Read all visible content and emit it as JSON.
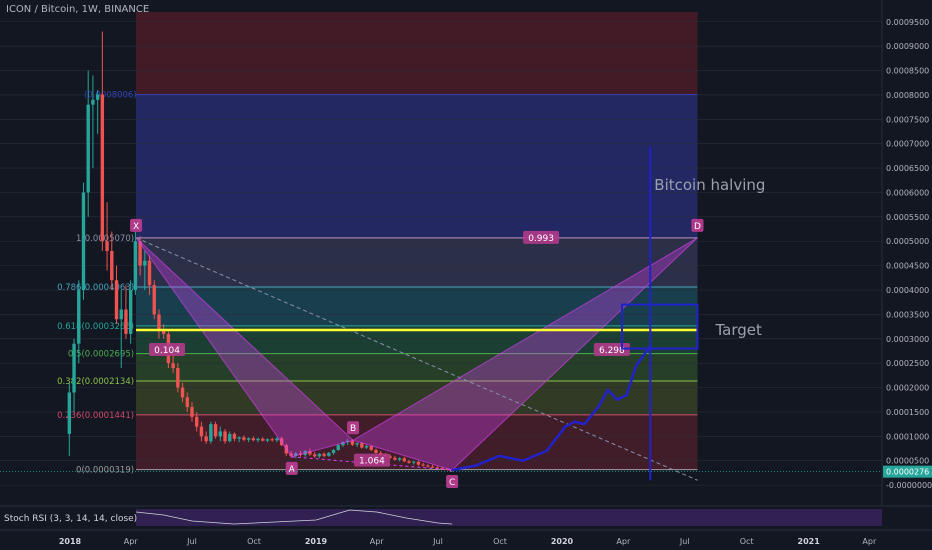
{
  "header": {
    "title": "ICON / Bitcoin, 1W, BINANCE"
  },
  "colors": {
    "background": "#131722",
    "up": "#26a69a",
    "down": "#ef5350",
    "pattern": "#e040fb",
    "projection": "#2222cc",
    "target_line": "#ffff33",
    "price_tag": "#26a69a"
  },
  "chart_data": {
    "type": "candlestick",
    "x_ticks": [
      "2018",
      "Apr",
      "Jul",
      "Oct",
      "2019",
      "Apr",
      "Jul",
      "Oct",
      "2020",
      "Apr",
      "Jul",
      "Oct",
      "2021",
      "Apr"
    ],
    "y_ticks": [
      "0.0009500",
      "0.0009000",
      "0.0008500",
      "0.0008000",
      "0.0007500",
      "0.0007000",
      "0.0006500",
      "0.0006000",
      "0.0005500",
      "0.0005000",
      "0.0004500",
      "0.0004000",
      "0.0003500",
      "0.0003000",
      "0.0002500",
      "0.0002000",
      "0.0001500",
      "0.0001000",
      "0.0000500",
      "-0.0000000"
    ],
    "last_price": "0.0000276",
    "y_range": [
      -1e-05,
      0.00097
    ],
    "fib_levels": [
      {
        "ratio": "1",
        "value": 0.0008006,
        "label": "(0.0008006)"
      },
      {
        "ratio": "1",
        "value": 0.000507,
        "label": "1(0.0005070)"
      },
      {
        "ratio": "0.786",
        "value": 0.0004063,
        "label": "0.786(0.0004063)"
      },
      {
        "ratio": "0.618",
        "value": 0.0003265,
        "label": "0.618(0.0003265)"
      },
      {
        "ratio": "0.5",
        "value": 0.0002695,
        "label": "0.5(0.0002695)"
      },
      {
        "ratio": "0.382",
        "value": 0.0002134,
        "label": "0.382(0.0002134)"
      },
      {
        "ratio": "0.236",
        "value": 0.0001441,
        "label": "0.236(0.0001441)"
      },
      {
        "ratio": "0",
        "value": 3.19e-05,
        "label": "0(0.0000319)"
      }
    ],
    "harmonic_points": [
      {
        "name": "X",
        "date": "2018-04-09",
        "value": 0.000507
      },
      {
        "name": "A",
        "date": "2018-11-26",
        "value": 5.8e-05
      },
      {
        "name": "B",
        "date": "2019-02-25",
        "value": 9.2e-05
      },
      {
        "name": "C",
        "date": "2019-07-22",
        "value": 3.1e-05
      },
      {
        "name": "D",
        "date": "2020-07-20",
        "value": 0.000507
      }
    ],
    "ratios": [
      {
        "label": "0.993",
        "date": "2019-12-01",
        "value": 0.000507
      },
      {
        "label": "0.104",
        "date": "2018-05-25",
        "value": 0.000277
      },
      {
        "label": "6.298",
        "date": "2020-03-15",
        "value": 0.000277
      },
      {
        "label": "1.064",
        "date": "2019-03-25",
        "value": 5.02e-05
      }
    ],
    "annotations": {
      "halving": "Bitcoin halving",
      "target": "Target"
    },
    "target_level": 0.000318,
    "target_box": {
      "start": "2020-03-30",
      "end": "2020-07-20",
      "top": 0.00037,
      "bottom": 0.00028
    },
    "halving_date": "2020-05-11",
    "halving_top": 0.000693,
    "indicator": {
      "title": "Stoch RSI (3, 3, 14, 14, close)"
    },
    "projection_path": [
      {
        "date": "2019-07-22",
        "value": 3.1e-05
      },
      {
        "date": "2019-08-26",
        "value": 4e-05
      },
      {
        "date": "2019-09-30",
        "value": 6e-05
      },
      {
        "date": "2019-11-04",
        "value": 5e-05
      },
      {
        "date": "2019-12-09",
        "value": 7e-05
      },
      {
        "date": "2020-01-06",
        "value": 0.00012
      },
      {
        "date": "2020-01-20",
        "value": 0.00013
      },
      {
        "date": "2020-02-03",
        "value": 0.000125
      },
      {
        "date": "2020-02-24",
        "value": 0.00016
      },
      {
        "date": "2020-03-09",
        "value": 0.000195
      },
      {
        "date": "2020-03-23",
        "value": 0.000175
      },
      {
        "date": "2020-04-06",
        "value": 0.000185
      },
      {
        "date": "2020-04-20",
        "value": 0.000245
      },
      {
        "date": "2020-05-11",
        "value": 0.000285
      }
    ],
    "candles": [
      {
        "date": "2017-12-31",
        "open": 0.000105,
        "high": 0.00021,
        "low": 6e-05,
        "close": 0.00019
      },
      {
        "date": "2018-01-07",
        "open": 0.00019,
        "high": 0.0003,
        "low": 0.00015,
        "close": 0.00029
      },
      {
        "date": "2018-01-14",
        "open": 0.00029,
        "high": 0.00042,
        "low": 0.00025,
        "close": 0.0004
      },
      {
        "date": "2018-01-21",
        "open": 0.0004,
        "high": 0.00062,
        "low": 0.00038,
        "close": 0.0006
      },
      {
        "date": "2018-01-28",
        "open": 0.0006,
        "high": 0.00085,
        "low": 0.00055,
        "close": 0.00078
      },
      {
        "date": "2018-02-04",
        "open": 0.00078,
        "high": 0.00084,
        "low": 0.00065,
        "close": 0.00079
      },
      {
        "date": "2018-02-11",
        "open": 0.00079,
        "high": 0.00081,
        "low": 0.00072,
        "close": 0.000801
      },
      {
        "date": "2018-02-18",
        "open": 0.000801,
        "high": 0.00093,
        "low": 0.00048,
        "close": 0.0005
      },
      {
        "date": "2018-02-25",
        "open": 0.0005,
        "high": 0.00058,
        "low": 0.00044,
        "close": 0.00048
      },
      {
        "date": "2018-03-04",
        "open": 0.00048,
        "high": 0.00052,
        "low": 0.0004,
        "close": 0.00042
      },
      {
        "date": "2018-03-11",
        "open": 0.00042,
        "high": 0.00045,
        "low": 0.00033,
        "close": 0.00034
      },
      {
        "date": "2018-03-18",
        "open": 0.00034,
        "high": 0.0004,
        "low": 0.00024,
        "close": 0.00036
      },
      {
        "date": "2018-03-25",
        "open": 0.00036,
        "high": 0.00041,
        "low": 0.0003,
        "close": 0.00031
      },
      {
        "date": "2018-04-01",
        "open": 0.00031,
        "high": 0.00042,
        "low": 0.00029,
        "close": 0.0004
      },
      {
        "date": "2018-04-08",
        "open": 0.0004,
        "high": 0.00052,
        "low": 0.00039,
        "close": 0.0005
      },
      {
        "date": "2018-04-15",
        "open": 0.0005,
        "high": 0.00051,
        "low": 0.00043,
        "close": 0.00045
      },
      {
        "date": "2018-04-22",
        "open": 0.00045,
        "high": 0.00048,
        "low": 0.0004,
        "close": 0.00046
      },
      {
        "date": "2018-04-29",
        "open": 0.00046,
        "high": 0.00047,
        "low": 0.00039,
        "close": 0.00041
      },
      {
        "date": "2018-05-06",
        "open": 0.00041,
        "high": 0.00042,
        "low": 0.00034,
        "close": 0.00035
      },
      {
        "date": "2018-05-13",
        "open": 0.00035,
        "high": 0.00036,
        "low": 0.0003,
        "close": 0.00032
      },
      {
        "date": "2018-05-20",
        "open": 0.00032,
        "high": 0.00033,
        "low": 0.0003,
        "close": 0.00031
      },
      {
        "date": "2018-05-27",
        "open": 0.00031,
        "high": 0.00032,
        "low": 0.00024,
        "close": 0.00025
      },
      {
        "date": "2018-06-03",
        "open": 0.00025,
        "high": 0.00027,
        "low": 0.00023,
        "close": 0.00024
      },
      {
        "date": "2018-06-10",
        "open": 0.00024,
        "high": 0.00025,
        "low": 0.00019,
        "close": 0.0002
      },
      {
        "date": "2018-06-17",
        "open": 0.0002,
        "high": 0.00021,
        "low": 0.00017,
        "close": 0.00018
      },
      {
        "date": "2018-06-24",
        "open": 0.00018,
        "high": 0.00019,
        "low": 0.00015,
        "close": 0.00016
      },
      {
        "date": "2018-07-01",
        "open": 0.00016,
        "high": 0.00017,
        "low": 0.00013,
        "close": 0.00014
      },
      {
        "date": "2018-07-08",
        "open": 0.00014,
        "high": 0.00015,
        "low": 0.00011,
        "close": 0.00012
      },
      {
        "date": "2018-07-15",
        "open": 0.00012,
        "high": 0.00013,
        "low": 9e-05,
        "close": 0.0001
      },
      {
        "date": "2018-07-22",
        "open": 0.0001,
        "high": 0.00011,
        "low": 8.5e-05,
        "close": 9e-05
      },
      {
        "date": "2018-07-29",
        "open": 9e-05,
        "high": 0.00013,
        "low": 8.5e-05,
        "close": 0.000125
      },
      {
        "date": "2018-08-05",
        "open": 0.000125,
        "high": 0.00013,
        "low": 9.5e-05,
        "close": 0.0001
      },
      {
        "date": "2018-08-12",
        "open": 0.0001,
        "high": 0.00012,
        "low": 9e-05,
        "close": 0.00011
      },
      {
        "date": "2018-08-19",
        "open": 0.00011,
        "high": 0.000115,
        "low": 8.5e-05,
        "close": 9e-05
      },
      {
        "date": "2018-08-26",
        "open": 9e-05,
        "high": 0.00011,
        "low": 8.8e-05,
        "close": 0.000105
      },
      {
        "date": "2018-09-02",
        "open": 0.000105,
        "high": 0.000108,
        "low": 9e-05,
        "close": 9.5e-05
      },
      {
        "date": "2018-09-09",
        "open": 9.5e-05,
        "high": 0.0001,
        "low": 8.8e-05,
        "close": 9.8e-05
      },
      {
        "date": "2018-09-16",
        "open": 9.8e-05,
        "high": 0.000102,
        "low": 9e-05,
        "close": 9.3e-05
      },
      {
        "date": "2018-09-23",
        "open": 9.3e-05,
        "high": 9.8e-05,
        "low": 8.8e-05,
        "close": 9.6e-05
      },
      {
        "date": "2018-09-30",
        "open": 9.6e-05,
        "high": 0.0001,
        "low": 9e-05,
        "close": 9.2e-05
      },
      {
        "date": "2018-10-07",
        "open": 9.2e-05,
        "high": 9.7e-05,
        "low": 8.8e-05,
        "close": 9.5e-05
      },
      {
        "date": "2018-10-14",
        "open": 9.5e-05,
        "high": 9.8e-05,
        "low": 9e-05,
        "close": 9.1e-05
      },
      {
        "date": "2018-10-21",
        "open": 9.1e-05,
        "high": 9.6e-05,
        "low": 8.8e-05,
        "close": 9.4e-05
      },
      {
        "date": "2018-10-28",
        "open": 9.4e-05,
        "high": 9.7e-05,
        "low": 8.9e-05,
        "close": 9.2e-05
      },
      {
        "date": "2018-11-04",
        "open": 9.2e-05,
        "high": 9.8e-05,
        "low": 8.8e-05,
        "close": 9.6e-05
      },
      {
        "date": "2018-11-11",
        "open": 9.6e-05,
        "high": 9.9e-05,
        "low": 8e-05,
        "close": 8.2e-05
      },
      {
        "date": "2018-11-18",
        "open": 8.2e-05,
        "high": 8.5e-05,
        "low": 6e-05,
        "close": 6.5e-05
      },
      {
        "date": "2018-11-25",
        "open": 6.5e-05,
        "high": 7e-05,
        "low": 5.6e-05,
        "close": 6e-05
      },
      {
        "date": "2018-12-02",
        "open": 6e-05,
        "high": 6.8e-05,
        "low": 5.5e-05,
        "close": 6.5e-05
      },
      {
        "date": "2018-12-09",
        "open": 6.5e-05,
        "high": 7e-05,
        "low": 5.8e-05,
        "close": 6.2e-05
      },
      {
        "date": "2018-12-16",
        "open": 6.2e-05,
        "high": 7.2e-05,
        "low": 5.8e-05,
        "close": 7e-05
      },
      {
        "date": "2018-12-23",
        "open": 7e-05,
        "high": 7.5e-05,
        "low": 6e-05,
        "close": 6.3e-05
      },
      {
        "date": "2018-12-30",
        "open": 6.3e-05,
        "high": 6.8e-05,
        "low": 5.6e-05,
        "close": 5.9e-05
      },
      {
        "date": "2019-01-06",
        "open": 5.9e-05,
        "high": 6.6e-05,
        "low": 5.5e-05,
        "close": 6.4e-05
      },
      {
        "date": "2019-01-13",
        "open": 6.4e-05,
        "high": 6.7e-05,
        "low": 5.7e-05,
        "close": 6e-05
      },
      {
        "date": "2019-01-20",
        "open": 6e-05,
        "high": 6.8e-05,
        "low": 5.8e-05,
        "close": 6.6e-05
      },
      {
        "date": "2019-01-27",
        "open": 6.6e-05,
        "high": 7.4e-05,
        "low": 6.2e-05,
        "close": 7.2e-05
      },
      {
        "date": "2019-02-03",
        "open": 7.2e-05,
        "high": 8.5e-05,
        "low": 7e-05,
        "close": 8.2e-05
      },
      {
        "date": "2019-02-10",
        "open": 8.2e-05,
        "high": 9e-05,
        "low": 7.8e-05,
        "close": 8.8e-05
      },
      {
        "date": "2019-02-17",
        "open": 8.8e-05,
        "high": 9.5e-05,
        "low": 8.2e-05,
        "close": 9.1e-05
      },
      {
        "date": "2019-02-24",
        "open": 9.1e-05,
        "high": 9.4e-05,
        "low": 8e-05,
        "close": 8.3e-05
      },
      {
        "date": "2019-03-03",
        "open": 8.3e-05,
        "high": 8.8e-05,
        "low": 7.8e-05,
        "close": 8.6e-05
      },
      {
        "date": "2019-03-10",
        "open": 8.6e-05,
        "high": 8.8e-05,
        "low": 7.5e-05,
        "close": 7.7e-05
      },
      {
        "date": "2019-03-17",
        "open": 7.7e-05,
        "high": 8.3e-05,
        "low": 7.4e-05,
        "close": 8e-05
      },
      {
        "date": "2019-03-24",
        "open": 8e-05,
        "high": 8.2e-05,
        "low": 7e-05,
        "close": 7.2e-05
      },
      {
        "date": "2019-03-31",
        "open": 7.2e-05,
        "high": 7.5e-05,
        "low": 6.4e-05,
        "close": 6.6e-05
      },
      {
        "date": "2019-04-07",
        "open": 6.6e-05,
        "high": 7e-05,
        "low": 6e-05,
        "close": 6.2e-05
      },
      {
        "date": "2019-04-14",
        "open": 6.2e-05,
        "high": 6.6e-05,
        "low": 5.7e-05,
        "close": 5.9e-05
      },
      {
        "date": "2019-04-21",
        "open": 5.9e-05,
        "high": 6.3e-05,
        "low": 5.4e-05,
        "close": 5.6e-05
      },
      {
        "date": "2019-04-28",
        "open": 5.6e-05,
        "high": 6e-05,
        "low": 5e-05,
        "close": 5.2e-05
      },
      {
        "date": "2019-05-05",
        "open": 5.2e-05,
        "high": 5.7e-05,
        "low": 4.9e-05,
        "close": 5.5e-05
      },
      {
        "date": "2019-05-12",
        "open": 5.5e-05,
        "high": 5.8e-05,
        "low": 4.7e-05,
        "close": 4.9e-05
      },
      {
        "date": "2019-05-19",
        "open": 4.9e-05,
        "high": 5.2e-05,
        "low": 4.4e-05,
        "close": 4.6e-05
      },
      {
        "date": "2019-05-26",
        "open": 4.6e-05,
        "high": 5e-05,
        "low": 4.2e-05,
        "close": 4.8e-05
      },
      {
        "date": "2019-06-02",
        "open": 4.8e-05,
        "high": 5e-05,
        "low": 4e-05,
        "close": 4.2e-05
      },
      {
        "date": "2019-06-09",
        "open": 4.2e-05,
        "high": 4.6e-05,
        "low": 3.8e-05,
        "close": 4e-05
      },
      {
        "date": "2019-06-16",
        "open": 4e-05,
        "high": 4.3e-05,
        "low": 3.6e-05,
        "close": 3.8e-05
      },
      {
        "date": "2019-06-23",
        "open": 3.8e-05,
        "high": 4.2e-05,
        "low": 3.5e-05,
        "close": 3.6e-05
      },
      {
        "date": "2019-06-30",
        "open": 3.6e-05,
        "high": 3.9e-05,
        "low": 3.3e-05,
        "close": 3.5e-05
      },
      {
        "date": "2019-07-07",
        "open": 3.5e-05,
        "high": 3.7e-05,
        "low": 3.2e-05,
        "close": 3.3e-05
      },
      {
        "date": "2019-07-14",
        "open": 3.3e-05,
        "high": 3.5e-05,
        "low": 3.1e-05,
        "close": 3.2e-05
      },
      {
        "date": "2019-07-21",
        "open": 3.2e-05,
        "high": 3.4e-05,
        "low": 2.7e-05,
        "close": 2.8e-05
      }
    ]
  }
}
